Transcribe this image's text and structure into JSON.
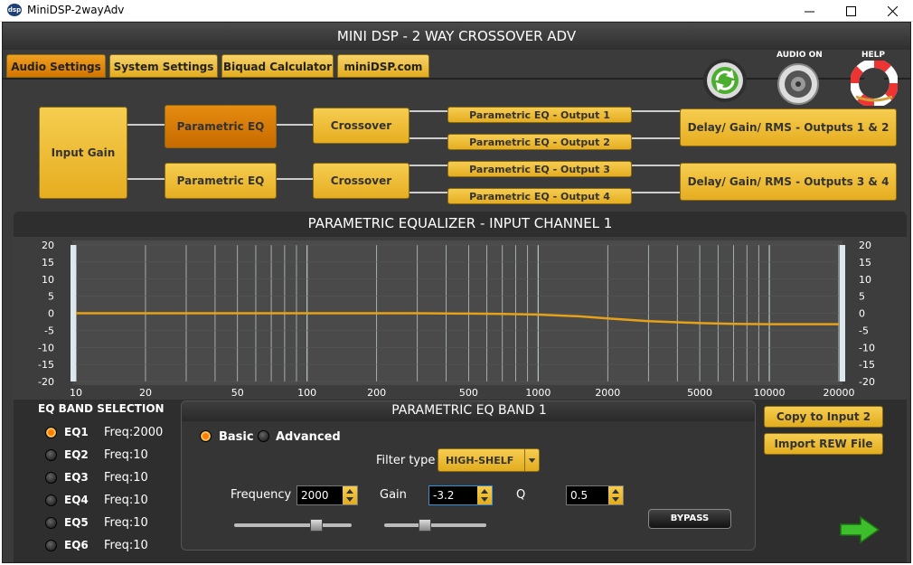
{
  "window": {
    "title": "MiniDSP-2wayAdv",
    "app_icon_text": "dsp"
  },
  "app": {
    "title": "MINI DSP - 2 WAY CROSSOVER ADV",
    "tabs": [
      {
        "label": "Audio Settings",
        "active": true
      },
      {
        "label": "System Settings",
        "active": false
      },
      {
        "label": "Biquad Calculator",
        "active": false
      },
      {
        "label": "miniDSP.com",
        "active": false
      }
    ],
    "corner": {
      "audio_label": "AUDIO ON",
      "help_label": "HELP"
    }
  },
  "flow": {
    "input_gain": "Input Gain",
    "peq_1": "Parametric EQ",
    "peq_2": "Parametric EQ",
    "xover_1": "Crossover",
    "xover_2": "Crossover",
    "out_peq": [
      "Parametric EQ - Output 1",
      "Parametric EQ - Output 2",
      "Parametric EQ - Output 3",
      "Parametric EQ - Output 4"
    ],
    "delay_12": "Delay/ Gain/ RMS - Outputs 1 & 2",
    "delay_34": "Delay/ Gain/ RMS - Outputs 3 & 4",
    "active_block": "peq_1"
  },
  "eq": {
    "title": "PARAMETRIC EQUALIZER - INPUT CHANNEL 1"
  },
  "chart_data": {
    "type": "line",
    "title": "PARAMETRIC EQUALIZER - INPUT CHANNEL 1",
    "xlabel": "",
    "ylabel": "",
    "x_scale": "log",
    "xlim": [
      10,
      20000
    ],
    "ylim": [
      -20,
      20
    ],
    "x_ticks": [
      "10",
      "20",
      "50",
      "100",
      "200",
      "500",
      "1000",
      "2000",
      "5000",
      "10000",
      "20000"
    ],
    "y_ticks": [
      "20",
      "15",
      "10",
      "5",
      "0",
      "-5",
      "-10",
      "-15",
      "-20"
    ],
    "grid": true,
    "series": [
      {
        "color": "#e6a118",
        "x": [
          10,
          20,
          50,
          100,
          200,
          300,
          500,
          700,
          1000,
          1500,
          2000,
          3000,
          5000,
          7000,
          10000,
          15000,
          20000
        ],
        "y": [
          0,
          0,
          0,
          0,
          0,
          0,
          -0.1,
          -0.2,
          -0.4,
          -0.9,
          -1.5,
          -2.3,
          -2.9,
          -3.1,
          -3.2,
          -3.2,
          -3.2
        ]
      }
    ]
  },
  "bands": {
    "heading": "EQ BAND SELECTION",
    "items": [
      {
        "name": "EQ1",
        "freq": "Freq:2000",
        "selected": true
      },
      {
        "name": "EQ2",
        "freq": "Freq:10",
        "selected": false
      },
      {
        "name": "EQ3",
        "freq": "Freq:10",
        "selected": false
      },
      {
        "name": "EQ4",
        "freq": "Freq:10",
        "selected": false
      },
      {
        "name": "EQ5",
        "freq": "Freq:10",
        "selected": false
      },
      {
        "name": "EQ6",
        "freq": "Freq:10",
        "selected": false
      }
    ]
  },
  "band_panel": {
    "title": "PARAMETRIC EQ BAND 1",
    "mode_basic": "Basic",
    "mode_advanced": "Advanced",
    "mode_selected": "Basic",
    "filter_type_label": "Filter type",
    "filter_type_value": "HIGH-SHELF",
    "frequency_label": "Frequency",
    "frequency_value": "2000",
    "gain_label": "Gain",
    "gain_value": "-3.2",
    "q_label": "Q",
    "q_value": "0.5",
    "bypass_label": "BYPASS"
  },
  "side": {
    "copy_label": "Copy to Input 2",
    "import_label": "Import REW File"
  },
  "colors": {
    "accent": "#e6ad20",
    "active_tab": "#d27400",
    "curve": "#e6a118"
  }
}
